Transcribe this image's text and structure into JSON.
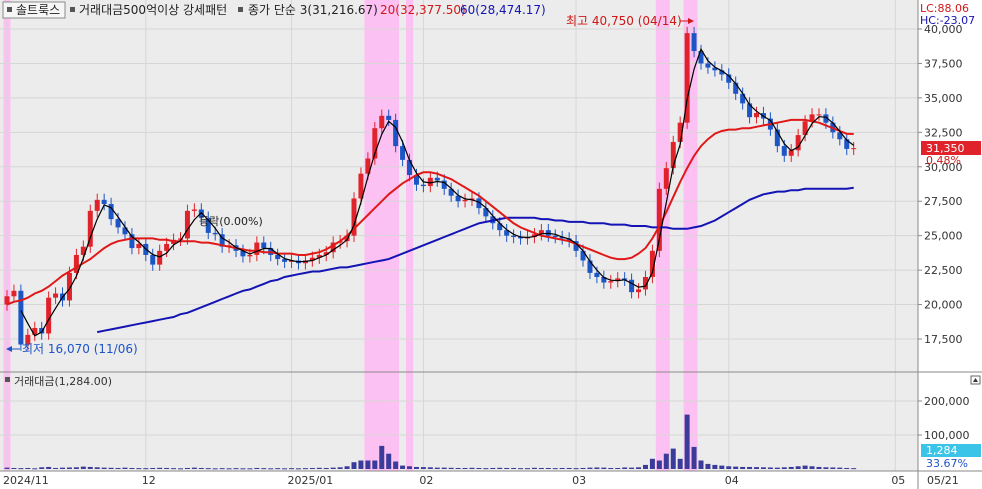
{
  "header": {
    "stock_name": "솔트룩스",
    "pattern_label": "거래대금500억이상 강세패턴",
    "ma_label": "종가 단순 3(31,216.67)",
    "ma20_label": "20(32,377.50)",
    "ma60_label": "60(28,474.17)",
    "lc_label": "LC:88.06",
    "hc_label": "HC:-23.07",
    "rise_fall_label": "등락(0.00%)"
  },
  "annotations": {
    "high_label": "최고 40,750 (04/14)",
    "low_label": "최저 16,070 (11/06)"
  },
  "price_panel": {
    "current_price_label": "31,350",
    "current_change_label": "0.48%",
    "y_ticks": [
      {
        "value": 17500,
        "label": "17,500"
      },
      {
        "value": 20000,
        "label": "20,000"
      },
      {
        "value": 22500,
        "label": "22,500"
      },
      {
        "value": 25000,
        "label": "25,000"
      },
      {
        "value": 27500,
        "label": "27,500"
      },
      {
        "value": 30000,
        "label": "30,000"
      },
      {
        "value": 32500,
        "label": "32,500"
      },
      {
        "value": 35000,
        "label": "35,000"
      },
      {
        "value": 37500,
        "label": "37,500"
      },
      {
        "value": 40000,
        "label": "40,000"
      }
    ]
  },
  "volume_panel": {
    "title": "거래대금(1,284.00)",
    "current_value_label": "1,284",
    "current_pct_label": "33.67%",
    "y_ticks": [
      {
        "value": 100000,
        "label": "100,000"
      },
      {
        "value": 200000,
        "label": "200,000"
      }
    ]
  },
  "x_axis": {
    "labels": [
      {
        "index": 0,
        "label": "2024/11"
      },
      {
        "index": 20,
        "label": "12"
      },
      {
        "index": 41,
        "label": "2025/01"
      },
      {
        "index": 60,
        "label": "02"
      },
      {
        "index": 82,
        "label": "03"
      },
      {
        "index": 104,
        "label": "04"
      },
      {
        "index": 128,
        "label": "05"
      }
    ],
    "end_label": "05/21"
  },
  "colors": {
    "up": "#e0232a",
    "down": "#1c55c6",
    "ma3": "#000000",
    "ma20": "#e01818",
    "ma60": "#1414b4",
    "highlight": "#ffb8f4",
    "price_badge": "#e0232a",
    "volume_badge": "#3cc4e8"
  },
  "chart_data": {
    "type": "candlestick",
    "close": [
      20600,
      21000,
      17100,
      17800,
      18300,
      17900,
      20500,
      20800,
      20300,
      22300,
      23600,
      24200,
      26800,
      27600,
      27300,
      26200,
      25600,
      25100,
      24100,
      24400,
      23600,
      22900,
      23900,
      24400,
      24700,
      24800,
      26800,
      26900,
      26300,
      25200,
      25100,
      24200,
      24300,
      23900,
      23500,
      23600,
      24500,
      24100,
      23600,
      23300,
      23100,
      23200,
      23000,
      23200,
      23400,
      23600,
      23800,
      24500,
      24600,
      25000,
      27700,
      29500,
      30600,
      32800,
      33700,
      33400,
      31500,
      30500,
      29400,
      28700,
      28600,
      29200,
      29000,
      28400,
      27900,
      27500,
      27600,
      27700,
      27000,
      26400,
      25900,
      25400,
      25000,
      24900,
      24800,
      24900,
      25100,
      25400,
      25000,
      24900,
      24800,
      24600,
      23900,
      23200,
      22300,
      22000,
      21600,
      21700,
      21900,
      21800,
      20900,
      21100,
      22000,
      23900,
      28400,
      29900,
      31800,
      33200,
      39700,
      38400,
      37500,
      37200,
      37000,
      36700,
      36100,
      35300,
      34600,
      33600,
      33900,
      33500,
      32700,
      31500,
      30800,
      31200,
      32300,
      33300,
      33800,
      33800,
      33200,
      32500,
      32000,
      31300,
      31350
    ],
    "ma20": [
      20000,
      20200,
      20300,
      20500,
      20800,
      21000,
      21300,
      21700,
      22100,
      22400,
      22700,
      23000,
      23300,
      23700,
      24100,
      24400,
      24600,
      24700,
      24800,
      24800,
      24800,
      24800,
      24700,
      24700,
      24600,
      24600,
      24600,
      24600,
      24500,
      24500,
      24400,
      24300,
      24200,
      24100,
      24000,
      23900,
      23900,
      23800,
      23800,
      23700,
      23700,
      23700,
      23600,
      23600,
      23700,
      23800,
      24000,
      24300,
      24600,
      25000,
      25500,
      26000,
      26500,
      27000,
      27500,
      28000,
      28400,
      28800,
      29100,
      29400,
      29600,
      29600,
      29500,
      29300,
      29100,
      28800,
      28500,
      28200,
      27900,
      27500,
      27100,
      26700,
      26300,
      25900,
      25600,
      25400,
      25200,
      25000,
      24900,
      24800,
      24700,
      24600,
      24400,
      24200,
      24000,
      23800,
      23600,
      23400,
      23300,
      23300,
      23400,
      23700,
      24100,
      24800,
      25700,
      26700,
      27800,
      28900,
      29900,
      30800,
      31500,
      32000,
      32400,
      32600,
      32700,
      32700,
      32800,
      32800,
      32900,
      33000,
      33100,
      33200,
      33300,
      33400,
      33400,
      33400,
      33300,
      33200,
      33000,
      32800,
      32600,
      32400,
      32377
    ],
    "ma60": [
      18000,
      18100,
      18200,
      18300,
      18400,
      18500,
      18600,
      18700,
      18800,
      18900,
      19000,
      19100,
      19300,
      19400,
      19600,
      19800,
      20000,
      20200,
      20400,
      20600,
      20800,
      21000,
      21100,
      21300,
      21500,
      21700,
      21800,
      22000,
      22100,
      22200,
      22300,
      22400,
      22400,
      22500,
      22600,
      22700,
      22700,
      22800,
      22900,
      23000,
      23100,
      23200,
      23300,
      23500,
      23700,
      23900,
      24100,
      24300,
      24500,
      24700,
      24900,
      25100,
      25300,
      25500,
      25700,
      25900,
      26000,
      26100,
      26200,
      26300,
      26300,
      26300,
      26300,
      26300,
      26200,
      26200,
      26100,
      26100,
      26000,
      26000,
      26000,
      25900,
      25900,
      25900,
      25800,
      25800,
      25800,
      25700,
      25700,
      25700,
      25600,
      25600,
      25600,
      25500,
      25500,
      25500,
      25600,
      25700,
      25900,
      26100,
      26400,
      26700,
      27000,
      27300,
      27600,
      27800,
      28000,
      28100,
      28200,
      28200,
      28300,
      28300,
      28400,
      28400,
      28400,
      28400,
      28400,
      28400,
      28400,
      28474
    ],
    "volume": [
      4000,
      3000,
      2500,
      3000,
      2000,
      5000,
      6000,
      3000,
      4000,
      4500,
      5000,
      7000,
      6000,
      5000,
      4000,
      3500,
      3000,
      4000,
      3000,
      2500,
      2500,
      3000,
      3500,
      3000,
      2500,
      2000,
      3000,
      4000,
      3000,
      2500,
      2000,
      2500,
      2000,
      2500,
      2000,
      2000,
      3000,
      2500,
      2000,
      2500,
      2000,
      2500,
      2000,
      2500,
      3000,
      3500,
      3000,
      4000,
      5000,
      8000,
      20000,
      25000,
      25000,
      25000,
      68000,
      45000,
      22000,
      10000,
      8000,
      6000,
      5500,
      5000,
      4000,
      4000,
      3500,
      3000,
      3000,
      3500,
      3000,
      2500,
      3000,
      3500,
      3000,
      3000,
      2500,
      2500,
      3500,
      3000,
      3000,
      2500,
      3000,
      3000,
      2500,
      3000,
      4000,
      4500,
      4000,
      3000,
      3000,
      4500,
      4000,
      5000,
      12000,
      30000,
      25000,
      45000,
      60000,
      30000,
      160000,
      65000,
      25000,
      15000,
      12000,
      10000,
      8000,
      7000,
      6000,
      6000,
      5500,
      5000,
      4500,
      4000,
      5000,
      6000,
      8000,
      10000,
      8000,
      6000,
      5000,
      4500,
      4000,
      3000,
      2500
    ]
  }
}
